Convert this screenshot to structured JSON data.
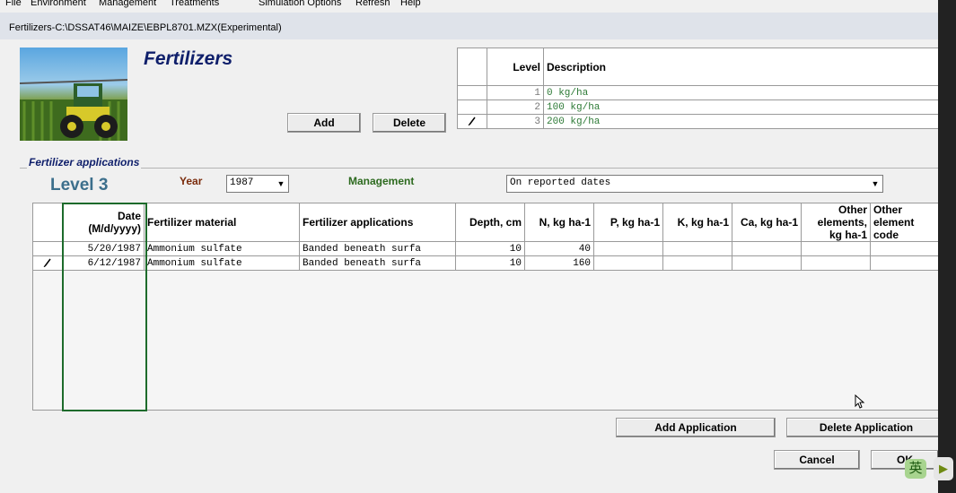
{
  "menu": {
    "file": "File",
    "environment": "Environment",
    "management": "Management",
    "treatments": "Treatments",
    "simulation_options": "Simulation Options",
    "refresh": "Refresh",
    "help": "Help"
  },
  "window": {
    "title": "Fertilizers-C:\\DSSAT46\\MAIZE\\EBPL8701.MZX(Experimental)"
  },
  "page": {
    "heading": "Fertilizers"
  },
  "level_buttons": {
    "add": "Add",
    "delete": "Delete"
  },
  "levels_table": {
    "headers": [
      "Level",
      "Description"
    ],
    "rows": [
      {
        "level": "1",
        "description": "0 kg/ha"
      },
      {
        "level": "2",
        "description": "100 kg/ha"
      },
      {
        "level": "3",
        "description": "200 kg/ha"
      }
    ],
    "row_marker_icon": "pencil-icon"
  },
  "applications": {
    "group_label": "Fertilizer applications",
    "level_label": "Level 3",
    "year_label": "Year",
    "year_value": "1987",
    "management_label": "Management",
    "management_value": "On reported dates",
    "headers": {
      "date_line1": "Date",
      "date_line2": "(M/d/yyyy)",
      "material": "Fertilizer material",
      "applications": "Fertilizer applications",
      "depth": "Depth, cm",
      "n": "N, kg ha-1",
      "p": "P, kg ha-1",
      "k": "K, kg ha-1",
      "ca": "Ca, kg ha-1",
      "other_line1": "Other",
      "other_line2": "elements,",
      "other_line3": "kg ha-1",
      "code_line1": "Other",
      "code_line2": "element",
      "code_line3": "code"
    },
    "rows": [
      {
        "date": "5/20/1987",
        "material": "Ammonium sulfate",
        "application": "Banded beneath surfa",
        "depth": "10",
        "n": "40"
      },
      {
        "date": "6/12/1987",
        "material": "Ammonium sulfate",
        "application": "Banded beneath surfa",
        "depth": "10",
        "n": "160"
      }
    ]
  },
  "bottom_buttons": {
    "add_application": "Add Application",
    "delete_application": "Delete Application",
    "cancel": "Cancel",
    "ok": "OK"
  },
  "ime": {
    "lang": "英"
  },
  "colors": {
    "heading": "#0f1f6b",
    "level_label": "#3c6f8c",
    "year_label": "#7a2b0b",
    "management_label": "#2d6a1f",
    "level_description": "#2d7a36",
    "highlight_box": "#1d6b2b"
  }
}
